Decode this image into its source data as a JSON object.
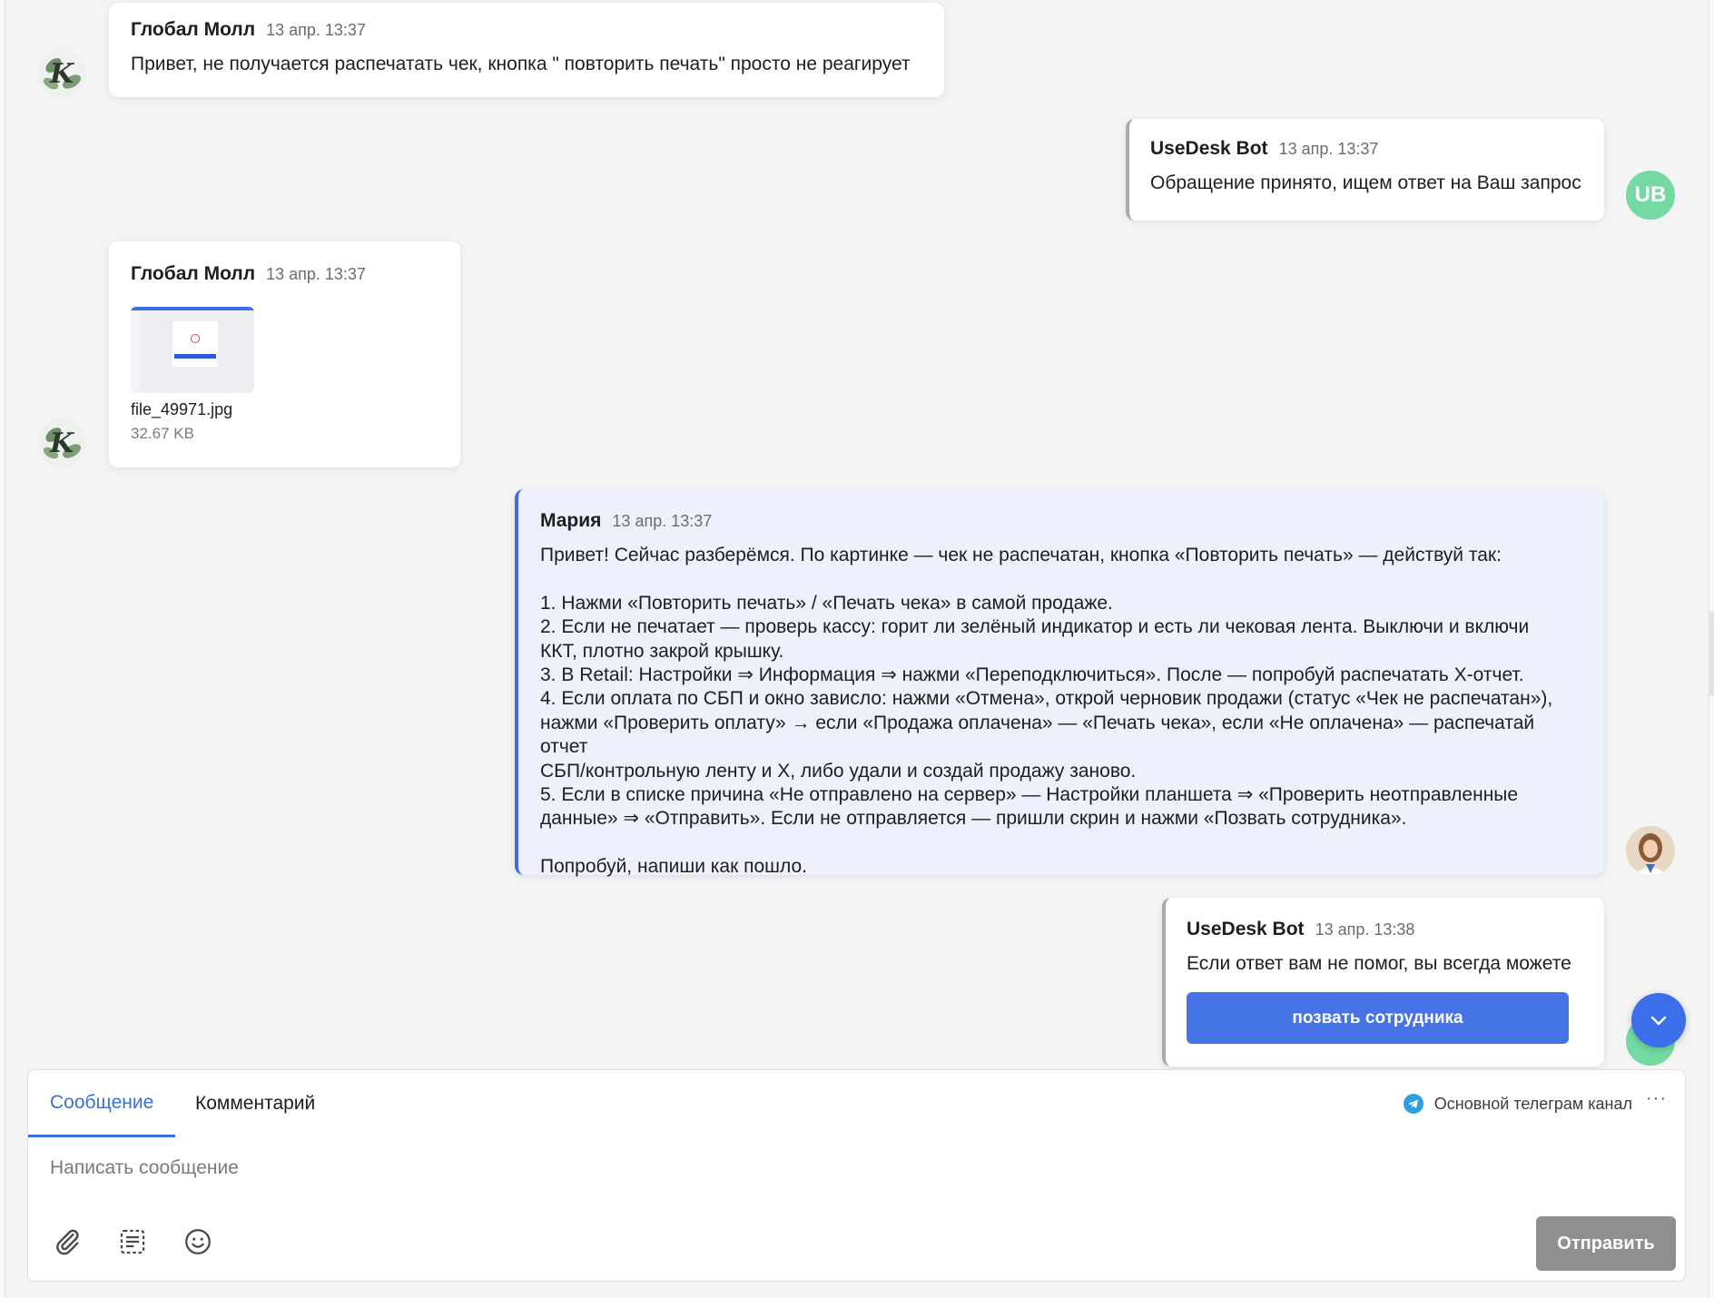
{
  "messages": [
    {
      "author": "Глобал Молл",
      "time": "13 апр. 13:37",
      "text": "Привет, не получается распечатать чек, кнопка \" повторить печать\" просто не реагирует"
    },
    {
      "author": "UseDesk Bot",
      "time": "13 апр. 13:37",
      "text": "Обращение принято, ищем ответ на Ваш запрос",
      "avatar": "UB"
    },
    {
      "author": "Глобал Молл",
      "time": "13 апр. 13:37",
      "file": {
        "name": "file_49971.jpg",
        "size": "32.67 KB"
      }
    },
    {
      "author": "Мария",
      "time": "13 апр. 13:37",
      "lines": [
        "Привет! Сейчас разберёмся. По картинке — чек не распечатан, кнопка «Повторить печать» — действуй так:",
        "",
        "1. Нажми «Повторить печать» / «Печать чека» в самой продаже.",
        "2. Если не печатает — проверь кассу: горит ли зелёный индикатор и есть ли чековая лента. Выключи и включи",
        "ККТ, плотно закрой крышку.",
        "3. В Retail: Настройки ⇒ Информация ⇒ нажми «Переподключиться». После — попробуй распечатать Х-отчет.",
        "4. Если оплата по СБП и окно зависло: нажми «Отмена», открой черновик продажи (статус «Чек не распечатан»),",
        "нажми «Проверить оплату» → если «Продажа оплачена» — «Печать чека», если «Не оплачена» — распечатай отчет",
        "СБП/контрольную ленту и Х, либо удали и создай продажу заново.",
        "5. Если в списке причина «Не отправлено на сервер» — Настройки планшета ⇒ «Проверить неотправленные",
        "данные» ⇒ «Отправить». Если не отправляется — пришли скрин и нажми «Позвать сотрудника».",
        "",
        "Попробуй, напиши как пошло."
      ]
    },
    {
      "author": "UseDesk Bot",
      "time": "13 апр. 13:38",
      "text": "Если ответ вам не помог, вы всегда можете",
      "button": "позвать сотрудника"
    }
  ],
  "composer": {
    "tabs": [
      "Сообщение",
      "Комментарий"
    ],
    "channel": "Основной телеграм канал",
    "more": "···",
    "placeholder": "Написать сообщение",
    "send": "Отправить"
  },
  "colors": {
    "accent": "#4673e6",
    "bot_avatar": "#74d9a2",
    "agent_bubble": "#edf1fb",
    "send_disabled": "#8f8f8f"
  },
  "icons": [
    "company-avatar",
    "bot-avatar",
    "agent-avatar",
    "telegram-icon",
    "paperclip-icon",
    "template-icon",
    "emoji-icon",
    "chevron-down-icon"
  ]
}
